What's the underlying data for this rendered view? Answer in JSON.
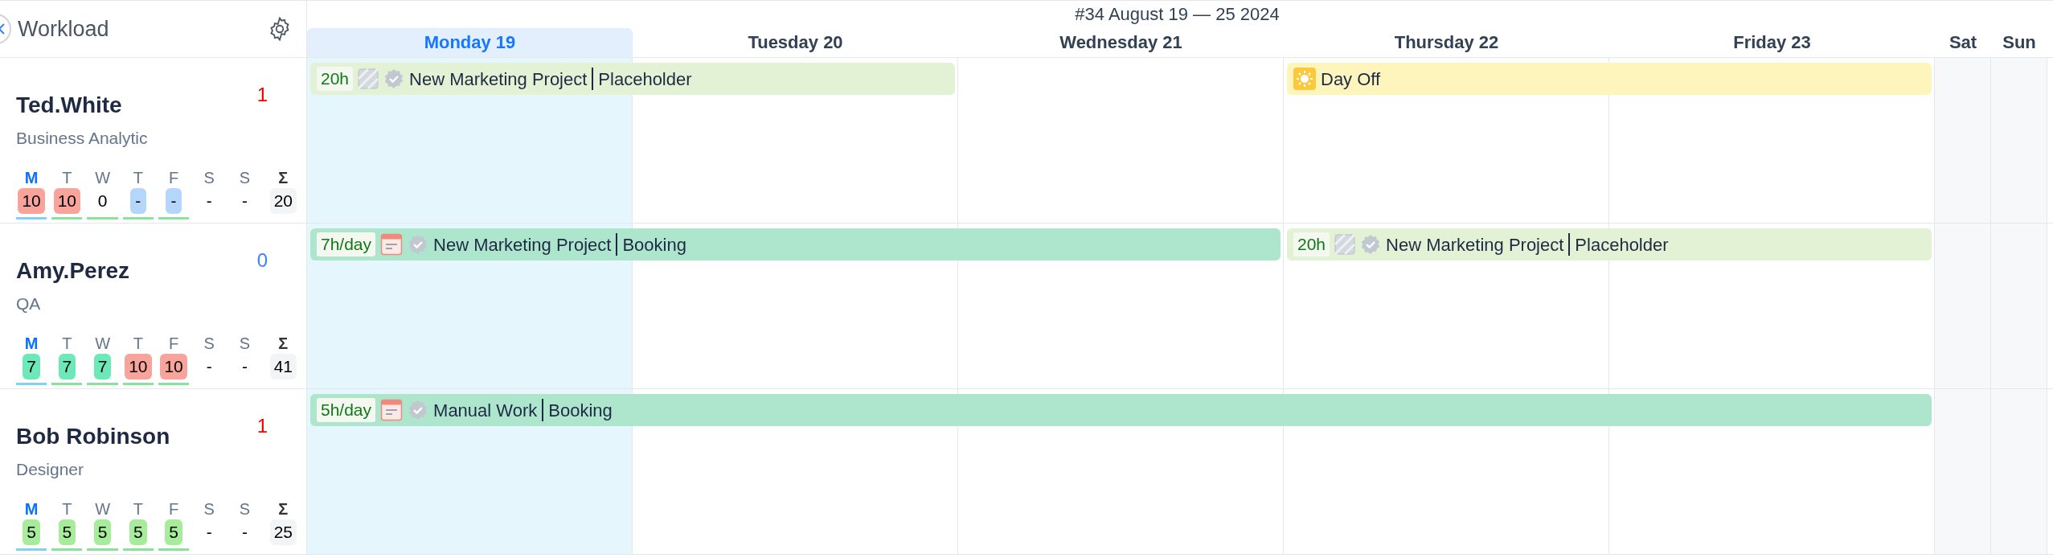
{
  "sidebar": {
    "title": "Workload"
  },
  "week": {
    "title": "#34 August 19 — 25 2024",
    "days": [
      {
        "label": "Monday 19",
        "selected": true,
        "weekend": false
      },
      {
        "label": "Tuesday 20",
        "selected": false,
        "weekend": false
      },
      {
        "label": "Wednesday 21",
        "selected": false,
        "weekend": false
      },
      {
        "label": "Thursday 22",
        "selected": false,
        "weekend": false
      },
      {
        "label": "Friday 23",
        "selected": false,
        "weekend": false
      },
      {
        "label": "Sat",
        "selected": false,
        "weekend": true
      },
      {
        "label": "Sun",
        "selected": false,
        "weekend": true
      }
    ]
  },
  "people": [
    {
      "name": "Ted.White",
      "role": "Business Analytic",
      "count": "1",
      "alert": true,
      "total_label": "Σ",
      "total": "20",
      "days": [
        {
          "letter": "M",
          "value": "10",
          "kind": "over",
          "selected": true
        },
        {
          "letter": "T",
          "value": "10",
          "kind": "over",
          "selected": false
        },
        {
          "letter": "W",
          "value": "0",
          "kind": "none",
          "selected": false
        },
        {
          "letter": "T",
          "value": "-",
          "kind": "off",
          "selected": false
        },
        {
          "letter": "F",
          "value": "-",
          "kind": "off",
          "selected": false
        },
        {
          "letter": "S",
          "value": "-",
          "kind": "none",
          "selected": false
        },
        {
          "letter": "S",
          "value": "-",
          "kind": "none",
          "selected": false
        }
      ],
      "bars": [
        {
          "kind": "placeholder",
          "hours": "20h",
          "project": "New Marketing Project",
          "type": "Placeholder"
        },
        {
          "kind": "dayoff",
          "project": "Day Off"
        }
      ]
    },
    {
      "name": "Amy.Perez",
      "role": "QA",
      "count": "0",
      "alert": false,
      "total_label": "Σ",
      "total": "41",
      "days": [
        {
          "letter": "M",
          "value": "7",
          "kind": "full",
          "selected": true
        },
        {
          "letter": "T",
          "value": "7",
          "kind": "full",
          "selected": false
        },
        {
          "letter": "W",
          "value": "7",
          "kind": "full",
          "selected": false
        },
        {
          "letter": "T",
          "value": "10",
          "kind": "over",
          "selected": false
        },
        {
          "letter": "F",
          "value": "10",
          "kind": "over",
          "selected": false
        },
        {
          "letter": "S",
          "value": "-",
          "kind": "none",
          "selected": false
        },
        {
          "letter": "S",
          "value": "-",
          "kind": "none",
          "selected": false
        }
      ],
      "bars": [
        {
          "kind": "booking",
          "hours": "7h/day",
          "project": "New Marketing Project",
          "type": "Booking"
        },
        {
          "kind": "placeholder",
          "hours": "20h",
          "project": "New Marketing Project",
          "type": "Placeholder"
        }
      ]
    },
    {
      "name": "Bob Robinson",
      "role": "Designer",
      "count": "1",
      "alert": true,
      "total_label": "Σ",
      "total": "25",
      "days": [
        {
          "letter": "M",
          "value": "5",
          "kind": "under",
          "selected": true
        },
        {
          "letter": "T",
          "value": "5",
          "kind": "under",
          "selected": false
        },
        {
          "letter": "W",
          "value": "5",
          "kind": "under",
          "selected": false
        },
        {
          "letter": "T",
          "value": "5",
          "kind": "under",
          "selected": false
        },
        {
          "letter": "F",
          "value": "5",
          "kind": "under",
          "selected": false
        },
        {
          "letter": "S",
          "value": "-",
          "kind": "none",
          "selected": false
        },
        {
          "letter": "S",
          "value": "-",
          "kind": "none",
          "selected": false
        }
      ],
      "bars": [
        {
          "kind": "booking",
          "hours": "5h/day",
          "project": "Manual Work",
          "type": "Booking"
        }
      ]
    }
  ]
}
